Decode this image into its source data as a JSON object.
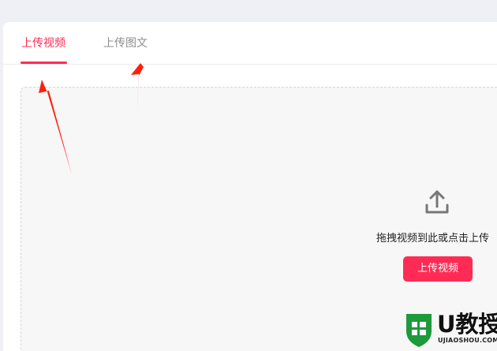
{
  "tabs": [
    {
      "label": "上传视频",
      "active": true
    },
    {
      "label": "上传图文",
      "active": false
    }
  ],
  "upload": {
    "icon": "upload-icon",
    "hint": "拖拽视频到此或点击上传",
    "button_label": "上传视频"
  },
  "watermark": {
    "brand": "U教授",
    "domain": "UJIAOSHOU.COM"
  },
  "colors": {
    "accent": "#ff2b54",
    "annotation": "#ff1f0f",
    "watermark_green": "#1d9a3b"
  }
}
